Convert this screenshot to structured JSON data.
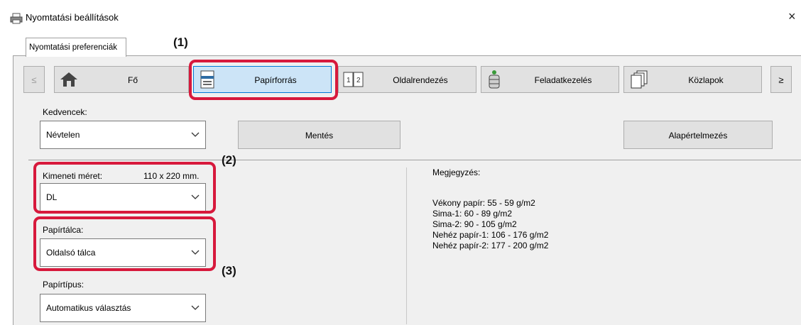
{
  "window": {
    "title": "Nyomtatási beállítások",
    "close_glyph": "×"
  },
  "tab": {
    "label": "Nyomtatási preferenciák"
  },
  "nav": {
    "prev": "≤",
    "next": "≥"
  },
  "categories": [
    {
      "label": "Fő",
      "icon": "home-icon"
    },
    {
      "label": "Papírforrás",
      "icon": "paper-tray-icon",
      "selected": true
    },
    {
      "label": "Oldalrendezés",
      "icon": "page-layout-icon"
    },
    {
      "label": "Feladatkezelés",
      "icon": "job-handling-icon"
    },
    {
      "label": "Közlapok",
      "icon": "inserts-icon"
    }
  ],
  "favorites": {
    "label": "Kedvencek:",
    "value": "Névtelen",
    "save_label": "Mentés",
    "default_label": "Alapértelmezés"
  },
  "output_size": {
    "label": "Kimeneti méret:",
    "dimensions": "110 x 220 mm.",
    "value": "DL"
  },
  "paper_tray": {
    "label": "Papírtálca:",
    "value": "Oldalsó tálca"
  },
  "paper_type": {
    "label": "Papírtípus:",
    "value": "Automatikus választás"
  },
  "notes": {
    "title": "Megjegyzés:",
    "lines": [
      "Vékony papír: 55 - 59 g/m2",
      "Sima-1: 60 - 89 g/m2",
      "Sima-2: 90 - 105 g/m2",
      "Nehéz papír-1: 106 - 176 g/m2",
      "Nehéz papír-2: 177 - 200 g/m2"
    ]
  },
  "callouts": {
    "c1": "(1)",
    "c2": "(2)",
    "c3": "(3)"
  },
  "colors": {
    "callout": "#d7193c",
    "selected_bg": "#cce4f7",
    "selected_border": "#0078d7"
  }
}
